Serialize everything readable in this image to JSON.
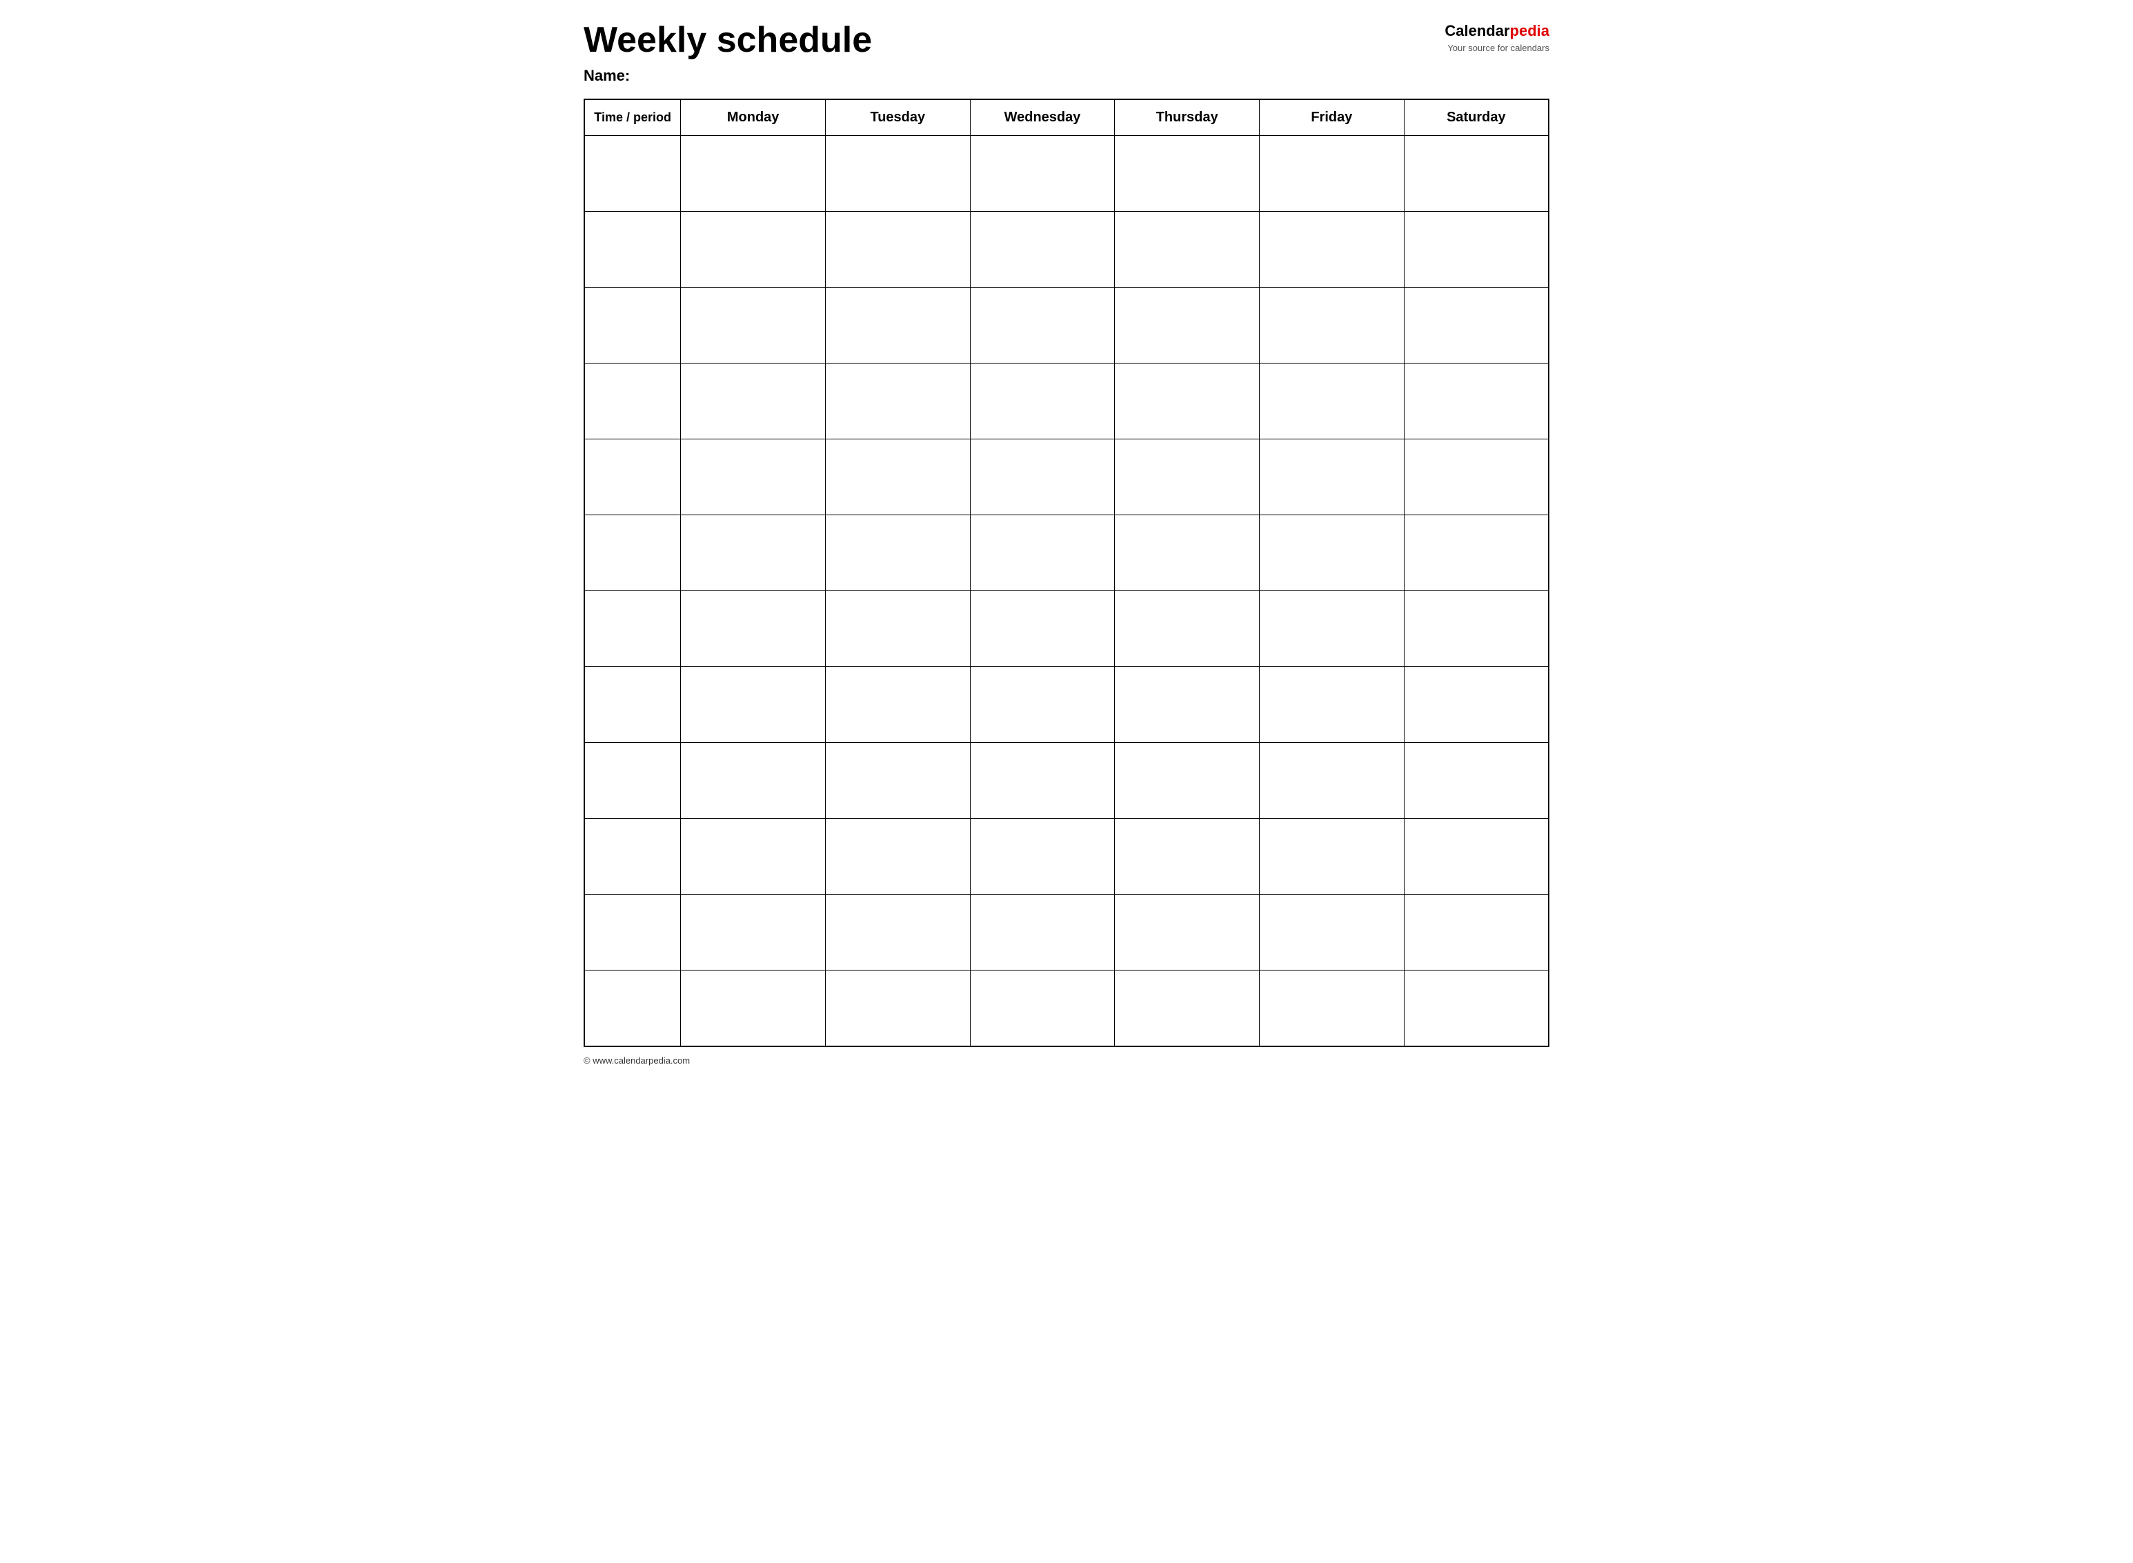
{
  "header": {
    "title": "Weekly schedule",
    "name_label": "Name:",
    "logo": {
      "calendar_part": "Calendar",
      "pedia_part": "pedia",
      "subtitle": "Your source for calendars"
    }
  },
  "table": {
    "columns": [
      "Time / period",
      "Monday",
      "Tuesday",
      "Wednesday",
      "Thursday",
      "Friday",
      "Saturday"
    ],
    "row_count": 12
  },
  "footer": {
    "url": "© www.calendarpedia.com"
  }
}
